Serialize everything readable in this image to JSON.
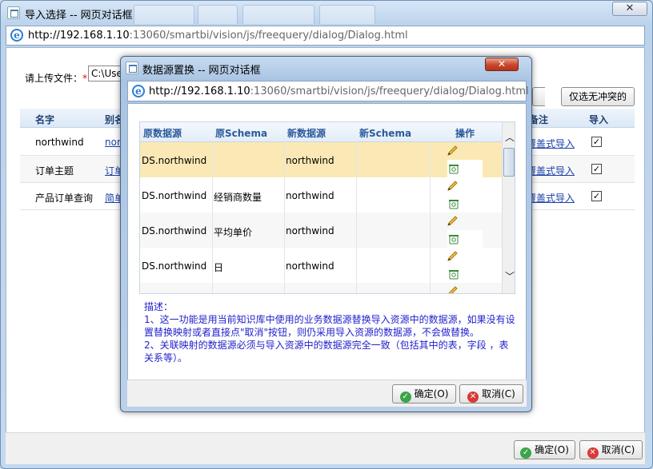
{
  "outer": {
    "title": "导入选择 -- 网页对话框",
    "close": "✕",
    "address_host": "http://192.168.1.10",
    "address_path": ":13060/smartbi/vision/js/freequery/dialog/Dialog.html",
    "upload_label": "请上传文件：",
    "upload_required": "*",
    "upload_value": "C:\\Use",
    "select_no_conflict": "仅选无冲突的",
    "columns": {
      "name": "名字",
      "alias": "别名",
      "remark": "备注",
      "import": "导入"
    },
    "rows": [
      {
        "name": "northwind",
        "alias": "nor",
        "remark": "覆盖式导入",
        "checked": "✓"
      },
      {
        "name": "订单主题",
        "alias": "订单",
        "remark": "覆盖式导入",
        "checked": "✓"
      },
      {
        "name": "产品订单查询",
        "alias": "简单",
        "remark": "覆盖式导入",
        "checked": "✓"
      }
    ],
    "ok": "确定(O)",
    "cancel": "取消(C)"
  },
  "dialog": {
    "title": "数据源置换 -- 网页对话框",
    "close": "✕",
    "address_host": "http://192.168.1.10",
    "address_path": ":13060/smartbi/vision/js/freequery/dialog/Dialog.html",
    "columns": {
      "src": "原数据源",
      "src_schema": "原Schema",
      "new": "新数据源",
      "new_schema": "新Schema",
      "action": "操作"
    },
    "rows": [
      {
        "src": "DS.northwind",
        "src_schema": "",
        "new": "northwind",
        "new_schema": ""
      },
      {
        "src": "DS.northwind",
        "src_schema": "经销商数量",
        "new": "northwind",
        "new_schema": ""
      },
      {
        "src": "DS.northwind",
        "src_schema": "平均单价",
        "new": "northwind",
        "new_schema": ""
      },
      {
        "src": "DS.northwind",
        "src_schema": "日",
        "new": "northwind",
        "new_schema": ""
      }
    ],
    "desc_title": "描述：",
    "desc_1": "1、这一功能是用当前知识库中使用的业务数据源替换导入资源中的数据源，如果没有设置替换映射或者直接点\"取消\"按钮，则仍采用导入资源的数据源，不会做替换。",
    "desc_2": "2、关联映射的数据源必须与导入资源中的数据源完全一致（包括其中的表，字段 ，表关系等）。",
    "ok": "确定(O)",
    "cancel": "取消(C)"
  },
  "icons": {
    "ie": "internet-explorer-icon",
    "edit": "pencil-icon",
    "delete": "trash-icon"
  },
  "colors": {
    "link": "#1a3fa8",
    "selected_row": "#fbe9b5",
    "description": "#2222cc"
  }
}
